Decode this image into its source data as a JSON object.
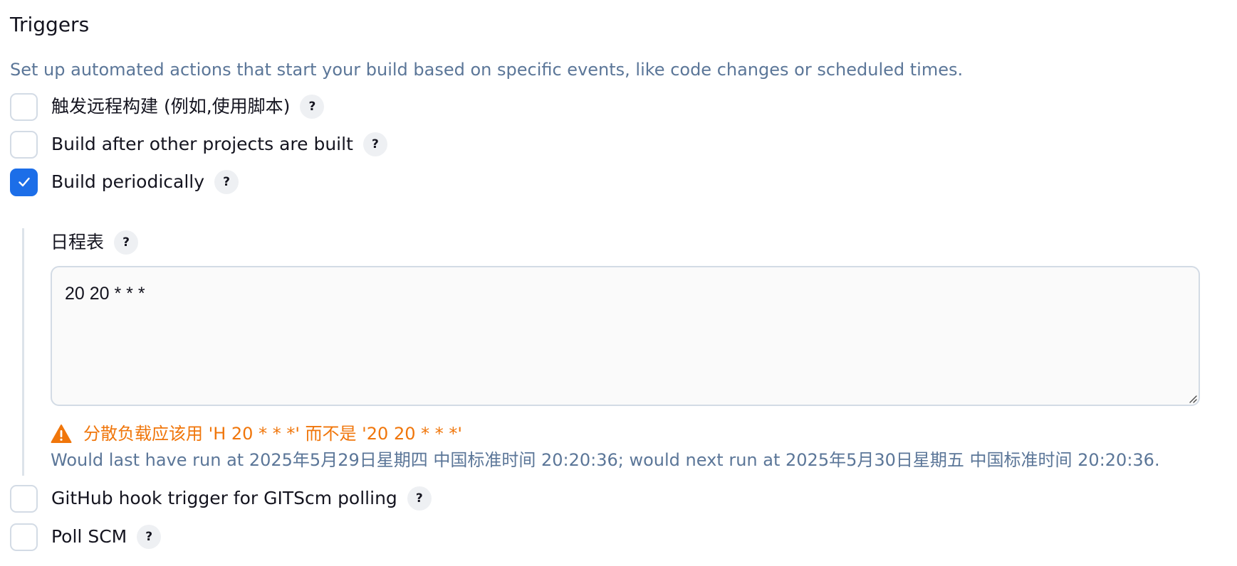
{
  "section": {
    "title": "Triggers",
    "description": "Set up automated actions that start your build based on specific events, like code changes or scheduled times."
  },
  "triggers": [
    {
      "label": "触发远程构建 (例如,使用脚本)",
      "checked": false,
      "help": "?"
    },
    {
      "label": "Build after other projects are built",
      "checked": false,
      "help": "?"
    },
    {
      "label": "Build periodically",
      "checked": true,
      "help": "?"
    },
    {
      "label": "GitHub hook trigger for GITScm polling",
      "checked": false,
      "help": "?"
    },
    {
      "label": "Poll SCM",
      "checked": false,
      "help": "?"
    }
  ],
  "schedule": {
    "label": "日程表",
    "help": "?",
    "value": "20 20 * * *",
    "warning": "分散负载应该用 'H 20 * * *' 而不是 '20 20 * * *'",
    "run_info": "Would last have run at 2025年5月29日星期四 中国标准时间 20:20:36; would next run at 2025年5月30日星期五 中国标准时间 20:20:36."
  },
  "icons": {
    "checkmark": "check-icon",
    "warning": "warning-triangle-icon",
    "resize": "resize-grip-icon"
  },
  "colors": {
    "accent": "#1c6ee8",
    "warning": "#f0760b",
    "muted_text": "#5b7698",
    "border": "#d3dbe5"
  }
}
